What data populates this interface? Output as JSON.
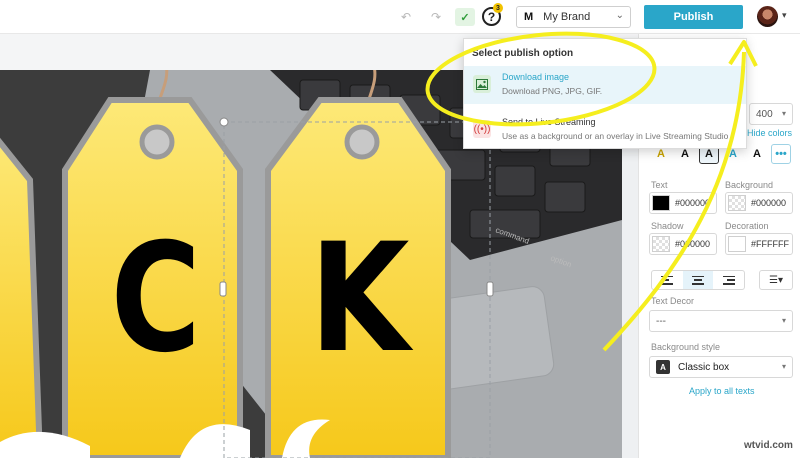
{
  "toolbar": {
    "help_count": "3",
    "brand_logo": "M",
    "brand_name": "My Brand",
    "publish_label": "Publish"
  },
  "publish_menu": {
    "title": "Select publish option",
    "options": [
      {
        "label": "Download image",
        "description": "Download PNG, JPG, GIF.",
        "icon": "image-icon"
      },
      {
        "label": "Send to Live Streaming",
        "description": "Use as a background or an overlay in Live Streaming Studio",
        "icon": "broadcast-icon"
      }
    ]
  },
  "canvas": {
    "tag_letters": [
      "C",
      "K"
    ],
    "keyboard_keys": [
      "command",
      "option"
    ]
  },
  "panel": {
    "font_size": "400",
    "hide_colors": "Hide colors",
    "style_buttons": [
      "A",
      "A",
      "A",
      "A",
      "A",
      "•••"
    ],
    "text_label": "Text",
    "text_color": "#000000",
    "background_label": "Background",
    "background_color": "#000000",
    "shadow_label": "Shadow",
    "shadow_color": "#000000",
    "decoration_label": "Decoration",
    "decoration_color": "#FFFFFF",
    "text_decor_label": "Text Decor",
    "text_decor_value": "---",
    "bg_style_label": "Background style",
    "bg_style_icon": "A",
    "bg_style_value": "Classic box",
    "apply_all": "Apply to all texts"
  },
  "colors": {
    "accent": "#2aa6c9",
    "tag_yellow": "#f8d233",
    "annotation_yellow": "#f5ee1e"
  },
  "watermark": "wtvid.com"
}
